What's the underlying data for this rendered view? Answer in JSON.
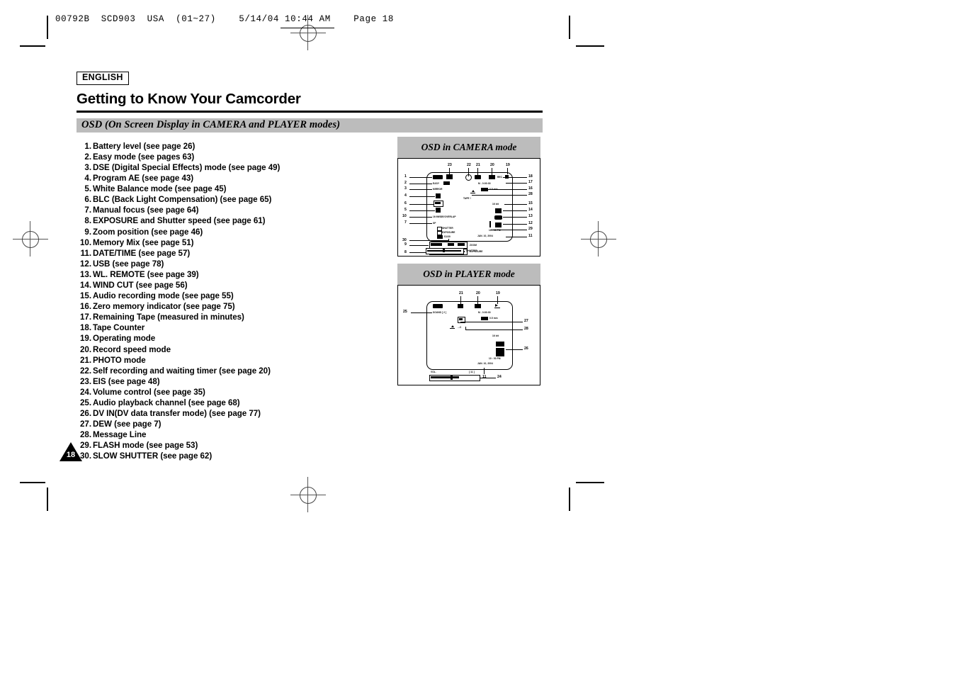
{
  "print_header": {
    "text": "00792B  SCD903  USA  (01~27)    5/14/04 10:44 AM    Page 18"
  },
  "language_badge": "ENGLISH",
  "page_title": "Getting to Know Your Camcorder",
  "section_heading": "OSD (On Screen Display in CAMERA and PLAYER modes)",
  "page_number": "18",
  "osd_list": [
    {
      "num": "1.",
      "text": "Battery level (see page 26)"
    },
    {
      "num": "2.",
      "text": "Easy mode (see pages 63)"
    },
    {
      "num": "3.",
      "text": "DSE (Digital Special Effects) mode (see page 49)"
    },
    {
      "num": "4.",
      "text": "Program AE (see page 43)"
    },
    {
      "num": "5.",
      "text": "White Balance mode (see page 45)"
    },
    {
      "num": "6.",
      "text": "BLC (Back Light Compensation) (see page 65)"
    },
    {
      "num": "7.",
      "text": "Manual focus (see page 64)"
    },
    {
      "num": "8.",
      "text": "EXPOSURE and Shutter speed  (see page 61)"
    },
    {
      "num": "9.",
      "text": "Zoom position (see page 46)"
    },
    {
      "num": "10.",
      "text": "Memory Mix (see page 51)"
    },
    {
      "num": "11.",
      "text": "DATE/TIME (see page 57)"
    },
    {
      "num": "12.",
      "text": "USB (see page 78)"
    },
    {
      "num": "13.",
      "text": "WL. REMOTE (see page 39)"
    },
    {
      "num": "14.",
      "text": "WIND CUT (see page 56)"
    },
    {
      "num": "15.",
      "text": "Audio recording mode (see page 55)"
    },
    {
      "num": "16.",
      "text": "Zero memory indicator (see page 75)"
    },
    {
      "num": "17.",
      "text": "Remaining Tape (measured in minutes)"
    },
    {
      "num": "18.",
      "text": "Tape Counter"
    },
    {
      "num": "19.",
      "text": "Operating mode"
    },
    {
      "num": "20.",
      "text": "Record speed mode"
    },
    {
      "num": "21.",
      "text": "PHOTO mode"
    },
    {
      "num": "22.",
      "text": "Self recording and waiting timer (see page 20)"
    },
    {
      "num": "23.",
      "text": "EIS (see page 48)"
    },
    {
      "num": "24.",
      "text": "Volume control (see page 35)"
    },
    {
      "num": "25.",
      "text": "Audio playback channel (see page 68)"
    },
    {
      "num": "26.",
      "text": "DV IN(DV data transfer mode) (see page 77)"
    },
    {
      "num": "27.",
      "text": "DEW (see page 7)"
    },
    {
      "num": "28.",
      "text": "Message Line"
    },
    {
      "num": "29.",
      "text": "FLASH mode (see page 53)"
    },
    {
      "num": "30.",
      "text": "SLOW SHUTTER (see page 62)"
    }
  ],
  "camera_panel": {
    "caption": "OSD in CAMERA mode",
    "callouts_top": [
      "23",
      "22",
      "21",
      "20",
      "19"
    ],
    "callouts_left": [
      "1",
      "2",
      "3",
      "4",
      "6",
      "5",
      "10",
      "7",
      "30",
      "9",
      "8"
    ],
    "callouts_right": [
      "18",
      "17",
      "16",
      "28",
      "15",
      "14",
      "13",
      "12",
      "29",
      "11"
    ],
    "screen_labels": {
      "rec": "REC",
      "easy": "EASY",
      "mirror": "MIRROR",
      "counter": "M - 0:00:00",
      "remaining": "0.5 min",
      "tape": "TAPE !",
      "wind": "16 bit",
      "overlap": "16:9WIDE/OVERLAP",
      "sp": "SP",
      "shutter": "SHUTTER",
      "exposure": "EXPOSURE",
      "slow": "S1/30",
      "time": "10 : 00 PM",
      "date": "JAN. 10, 2004"
    },
    "bar_labels": [
      "ZOOM",
      "EXPOSURE",
      "SHUTTER"
    ]
  },
  "player_panel": {
    "caption": "OSD in PLAYER mode",
    "callouts_top": [
      "21",
      "20",
      "19"
    ],
    "callouts_left": [
      "25"
    ],
    "callouts_right": [
      "27",
      "28",
      "26"
    ],
    "callouts_bottom": [
      "24",
      "11"
    ],
    "screen_labels": {
      "sound": "SOUND [ 2 ]",
      "counter": "M - 0:00:00",
      "remaining": "0.5 min",
      "message": "...C",
      "wind": "16 bit",
      "time": "10 : 00 PM",
      "date": "JAN. 10, 2004",
      "vol": "VOL.",
      "vol_value": "[ 11 ]"
    }
  },
  "colors": {
    "band_gray": "#bcbcbc",
    "ink": "#000000",
    "paper": "#ffffff"
  }
}
